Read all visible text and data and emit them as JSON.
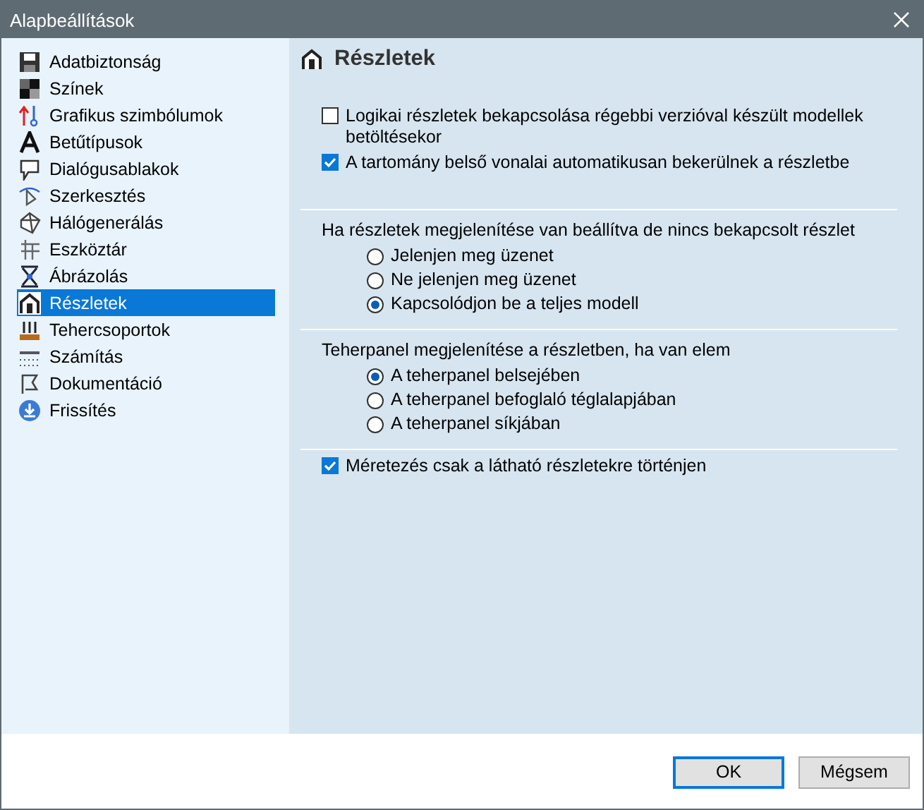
{
  "window": {
    "title": "Alapbeállítások"
  },
  "sidebar": {
    "items": [
      {
        "label": "Adatbiztonság",
        "selected": false
      },
      {
        "label": "Színek",
        "selected": false
      },
      {
        "label": "Grafikus szimbólumok",
        "selected": false
      },
      {
        "label": "Betűtípusok",
        "selected": false
      },
      {
        "label": "Dialógusablakok",
        "selected": false
      },
      {
        "label": "Szerkesztés",
        "selected": false
      },
      {
        "label": "Hálógenerálás",
        "selected": false
      },
      {
        "label": "Eszköztár",
        "selected": false
      },
      {
        "label": "Ábrázolás",
        "selected": false
      },
      {
        "label": "Részletek",
        "selected": true
      },
      {
        "label": "Tehercsoportok",
        "selected": false
      },
      {
        "label": "Számítás",
        "selected": false
      },
      {
        "label": "Dokumentáció",
        "selected": false
      },
      {
        "label": "Frissítés",
        "selected": false
      }
    ]
  },
  "panel": {
    "title": "Részletek",
    "sections": [
      {
        "kind": "checkboxes",
        "items": [
          {
            "label": "Logikai részletek bekapcsolása régebbi verzióval készült modellek betöltésekor",
            "checked": false
          },
          {
            "label": "A tartomány belső vonalai automatikusan bekerülnek a részletbe",
            "checked": true
          }
        ]
      },
      {
        "kind": "radios",
        "label": "Ha részletek megjelenítése van beállítva de nincs bekapcsolt részlet",
        "items": [
          {
            "label": "Jelenjen meg üzenet",
            "selected": false
          },
          {
            "label": "Ne jelenjen meg üzenet",
            "selected": false
          },
          {
            "label": "Kapcsolódjon be a teljes modell",
            "selected": true
          }
        ]
      },
      {
        "kind": "radios",
        "label": "Teherpanel megjelenítése a részletben, ha van elem",
        "items": [
          {
            "label": "A teherpanel belsejében",
            "selected": true
          },
          {
            "label": "A teherpanel befoglaló téglalapjában",
            "selected": false
          },
          {
            "label": "A teherpanel síkjában",
            "selected": false
          }
        ]
      },
      {
        "kind": "checkboxes",
        "items": [
          {
            "label": "Méretezés csak a látható részletekre történjen",
            "checked": true
          }
        ]
      }
    ]
  },
  "buttons": [
    {
      "label": "OK",
      "default": true
    },
    {
      "label": "Mégsem",
      "default": false
    }
  ]
}
